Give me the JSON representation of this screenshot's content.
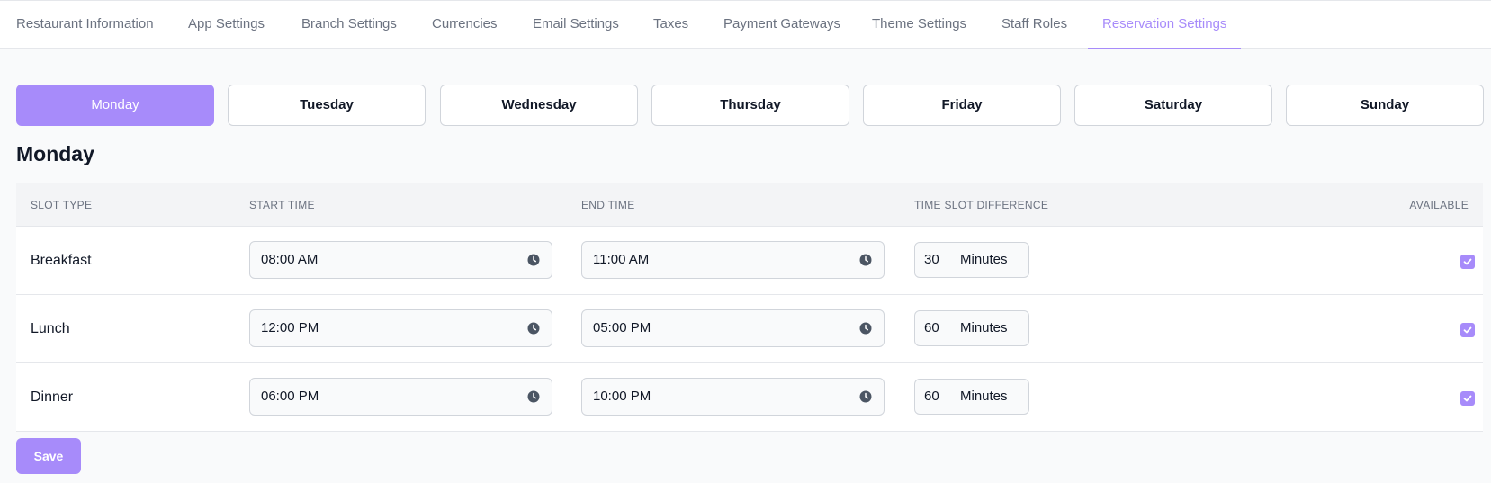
{
  "tabs": [
    {
      "label": "Restaurant Information"
    },
    {
      "label": "App Settings"
    },
    {
      "label": "Branch Settings"
    },
    {
      "label": "Currencies"
    },
    {
      "label": "Email Settings"
    },
    {
      "label": "Taxes"
    },
    {
      "label": "Payment Gateways"
    },
    {
      "label": "Theme Settings"
    },
    {
      "label": "Staff Roles"
    },
    {
      "label": "Reservation Settings",
      "active": true
    }
  ],
  "days": [
    {
      "label": "Monday",
      "active": true
    },
    {
      "label": "Tuesday"
    },
    {
      "label": "Wednesday"
    },
    {
      "label": "Thursday"
    },
    {
      "label": "Friday"
    },
    {
      "label": "Saturday"
    },
    {
      "label": "Sunday"
    }
  ],
  "selected_day": "Monday",
  "table": {
    "headers": {
      "slot_type": "SLOT TYPE",
      "start_time": "START TIME",
      "end_time": "END TIME",
      "time_slot_difference": "TIME SLOT DIFFERENCE",
      "available": "AVAILABLE"
    },
    "rows": [
      {
        "type": "Breakfast",
        "start": "08:00 AM",
        "end": "11:00 AM",
        "difference": "30",
        "unit": "Minutes",
        "available": true
      },
      {
        "type": "Lunch",
        "start": "12:00 PM",
        "end": "05:00 PM",
        "difference": "60",
        "unit": "Minutes",
        "available": true
      },
      {
        "type": "Dinner",
        "start": "06:00 PM",
        "end": "10:00 PM",
        "difference": "60",
        "unit": "Minutes",
        "available": true
      }
    ]
  },
  "save_label": "Save",
  "colors": {
    "accent": "#a78bfa",
    "background": "#f9fafb",
    "header_bg": "#f3f4f6",
    "text": "#111827",
    "muted_text": "#6b7280"
  },
  "icons": {
    "time_input": "clock-icon",
    "checkbox": "check-icon"
  }
}
